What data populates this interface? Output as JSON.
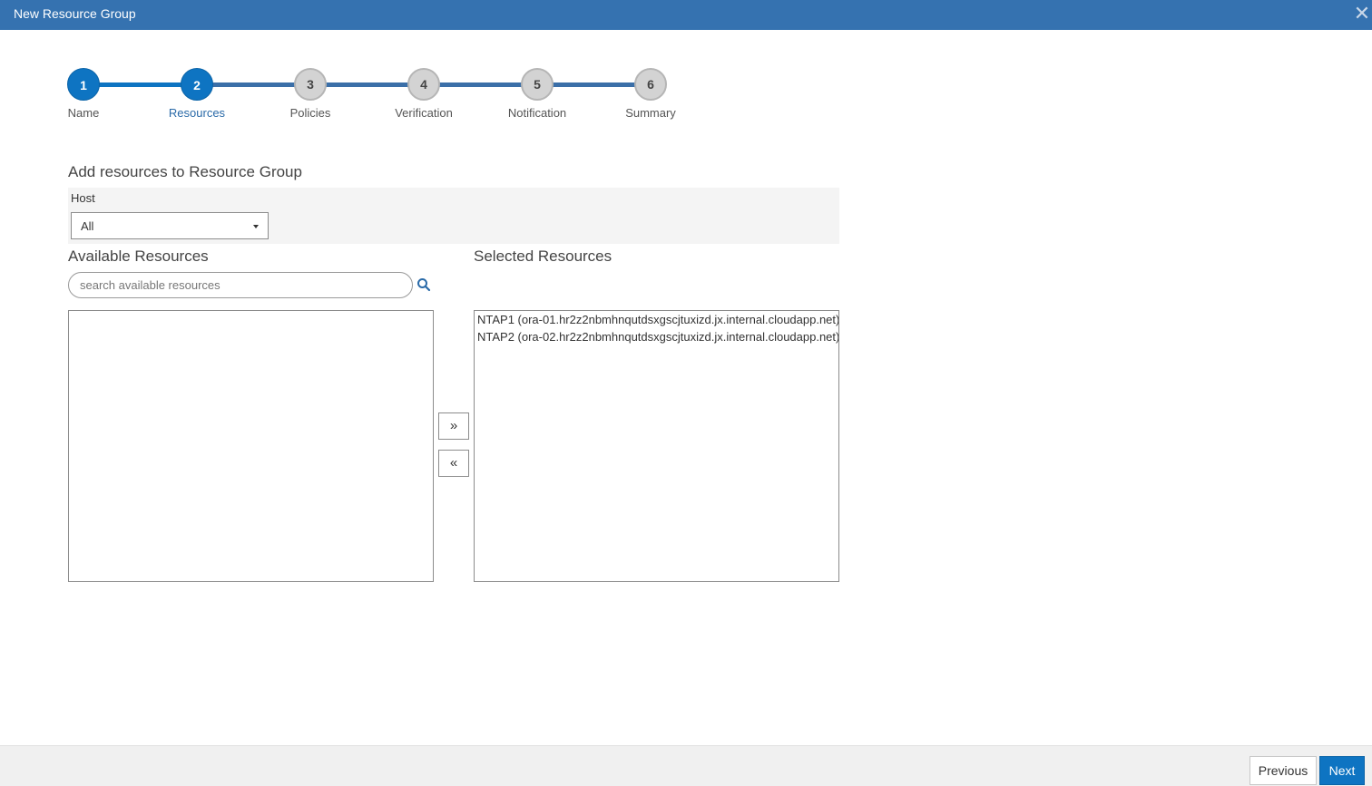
{
  "window": {
    "title": "New Resource Group",
    "close_icon": "close-icon"
  },
  "wizard": {
    "steps": [
      {
        "number": "1",
        "label": "Name",
        "state": "completed"
      },
      {
        "number": "2",
        "label": "Resources",
        "state": "current"
      },
      {
        "number": "3",
        "label": "Policies",
        "state": "pending"
      },
      {
        "number": "4",
        "label": "Verification",
        "state": "pending"
      },
      {
        "number": "5",
        "label": "Notification",
        "state": "pending"
      },
      {
        "number": "6",
        "label": "Summary",
        "state": "pending"
      }
    ]
  },
  "main": {
    "heading": "Add resources to Resource Group",
    "host": {
      "label": "Host",
      "selected": "All"
    },
    "available": {
      "heading": "Available Resources",
      "search_placeholder": "search available resources",
      "items": []
    },
    "selected": {
      "heading": "Selected Resources",
      "items": [
        "NTAP1 (ora-01.hr2z2nbmhnqutdsxgscjtuxizd.jx.internal.cloudapp.net)",
        "NTAP2 (ora-02.hr2z2nbmhnqutdsxgscjtuxizd.jx.internal.cloudapp.net)"
      ]
    },
    "move_right": "»",
    "move_left": "«"
  },
  "footer": {
    "previous": "Previous",
    "next": "Next"
  },
  "colors": {
    "accent": "#0e74c2",
    "titlebar": "#3572b0",
    "pending": "#d3d3d3"
  }
}
